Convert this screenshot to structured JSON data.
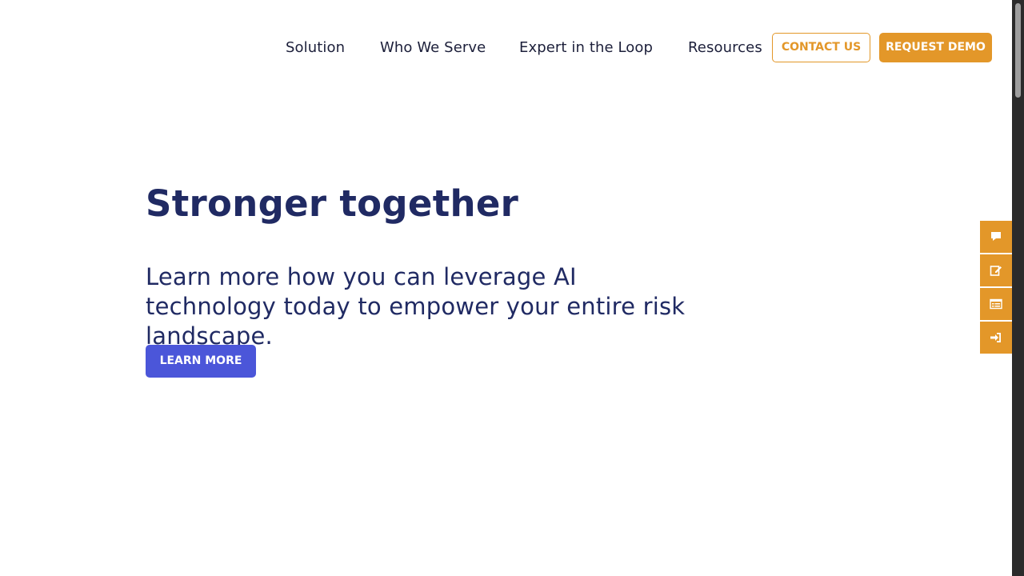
{
  "nav": {
    "links": [
      "Solution",
      "Who We Serve",
      "Expert in the Loop",
      "Resources"
    ],
    "contact_label": "CONTACT US",
    "demo_label": "REQUEST DEMO"
  },
  "hero": {
    "title": "Stronger together",
    "subtitle": "Learn more how you can leverage AI technology today to empower your entire risk landscape.",
    "cta_label": "LEARN MORE"
  },
  "side_tabs": {
    "icons": [
      "chat-icon",
      "edit-icon",
      "form-icon",
      "login-icon"
    ]
  },
  "colors": {
    "accent_orange": "#e39729",
    "cta_blue": "#4b56d9",
    "heading_navy": "#202a63",
    "nav_text": "#1c1f3a"
  }
}
